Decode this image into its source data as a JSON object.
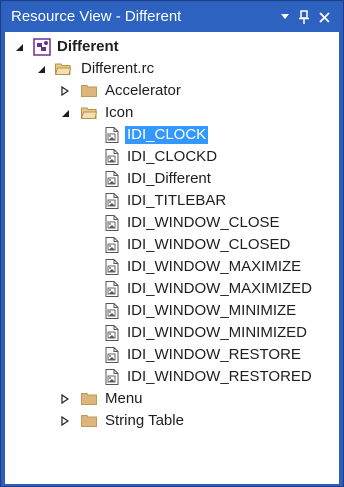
{
  "window": {
    "title": "Resource View - Different",
    "menu_glyph": "▾",
    "pin_glyph": "⊥",
    "close_glyph": "✕"
  },
  "tree": {
    "root": {
      "label": "Different",
      "expanded": true
    },
    "rc_file": {
      "label": "Different.rc",
      "expanded": true
    },
    "folders": {
      "accelerator": "Accelerator",
      "icon": "Icon",
      "menu": "Menu",
      "string_table": "String Table"
    },
    "icons": [
      "IDI_CLOCK",
      "IDI_CLOCKD",
      "IDI_Different",
      "IDI_TITLEBAR",
      "IDI_WINDOW_CLOSE",
      "IDI_WINDOW_CLOSED",
      "IDI_WINDOW_MAXIMIZE",
      "IDI_WINDOW_MAXIMIZED",
      "IDI_WINDOW_MINIMIZE",
      "IDI_WINDOW_MINIMIZED",
      "IDI_WINDOW_RESTORE",
      "IDI_WINDOW_RESTORED"
    ],
    "selected": "IDI_CLOCK"
  },
  "colors": {
    "title_bg": "#2d62c0",
    "selection": "#3399ff",
    "folder": "#dcb67a"
  }
}
